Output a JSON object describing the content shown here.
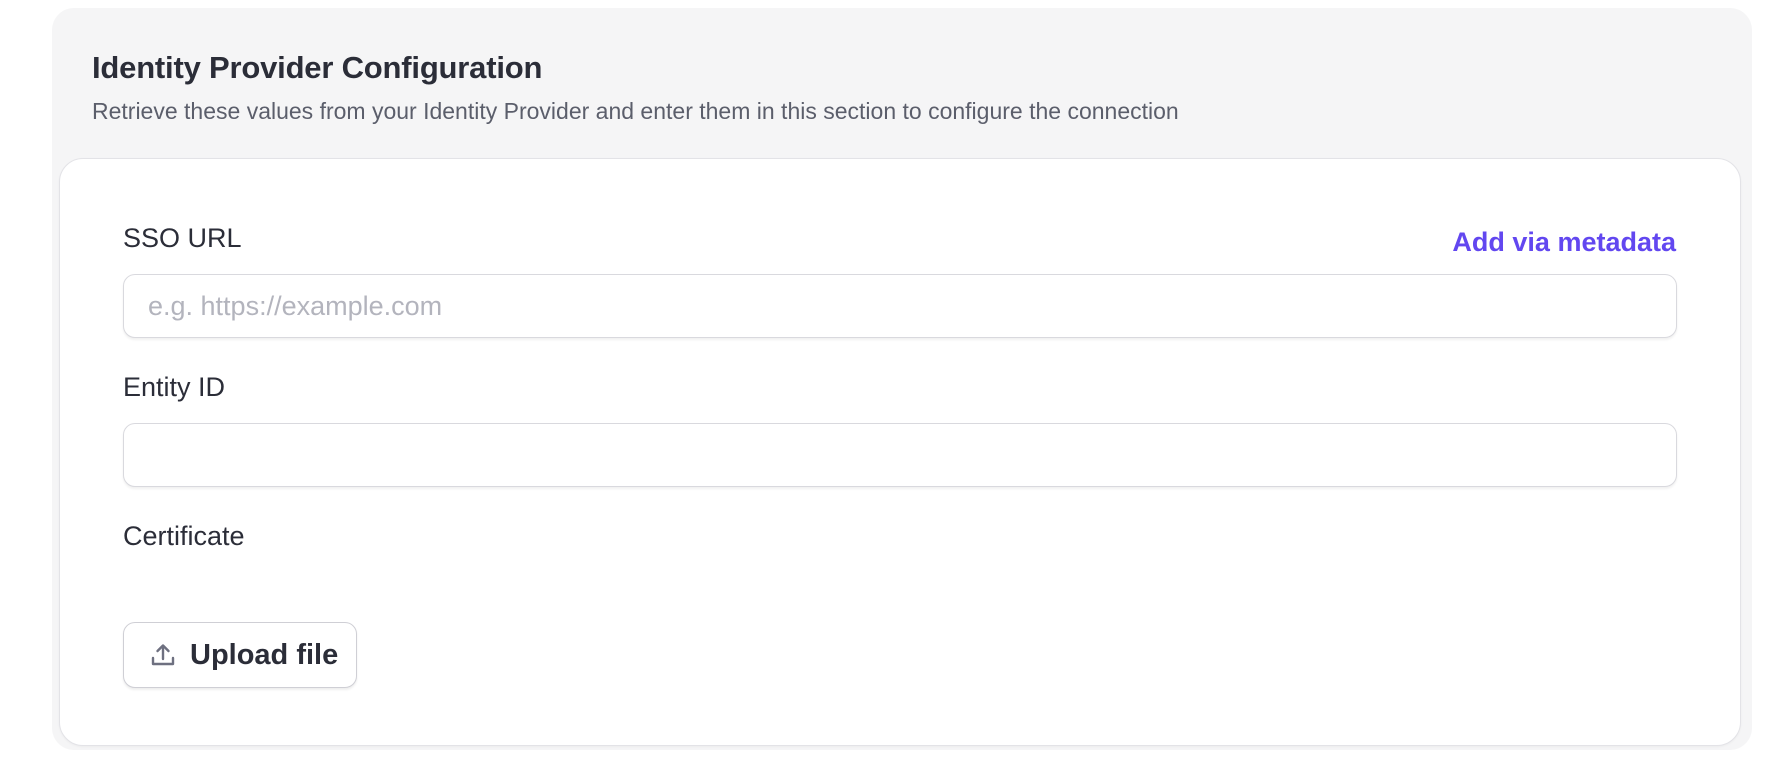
{
  "section": {
    "title": "Identity Provider Configuration",
    "description": "Retrieve these values from your Identity Provider and enter them in this section to configure the connection"
  },
  "fields": {
    "sso_url": {
      "label": "SSO URL",
      "value": "",
      "placeholder": "e.g. https://example.com",
      "metadata_link": "Add via metadata"
    },
    "entity_id": {
      "label": "Entity ID",
      "value": "",
      "placeholder": ""
    },
    "certificate": {
      "label": "Certificate",
      "upload_button": "Upload file",
      "icon": "upload-icon"
    }
  },
  "colors": {
    "accent": "#6247f0",
    "panel_background": "#f5f5f6",
    "placeholder": "#b3b4bd"
  }
}
